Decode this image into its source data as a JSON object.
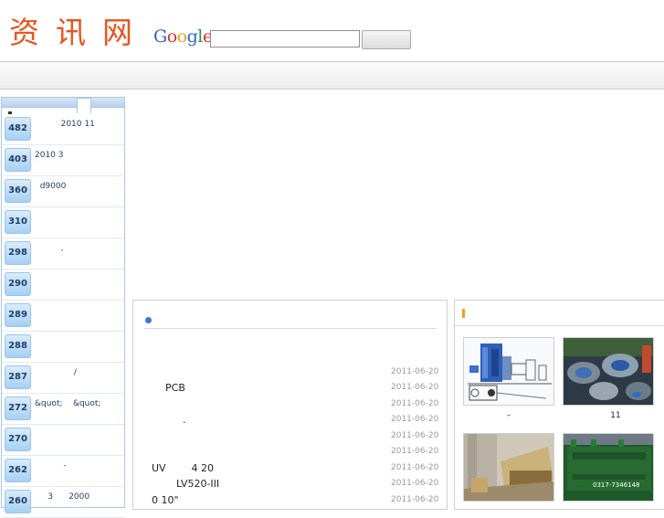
{
  "header": {
    "logo_text": "资讯网",
    "search_button_label": ""
  },
  "google_logo": [
    {
      "ch": "G",
      "color": "#2f62c9"
    },
    {
      "ch": "o",
      "color": "#d8322a"
    },
    {
      "ch": "o",
      "color": "#e8a617"
    },
    {
      "ch": "g",
      "color": "#2f62c9"
    },
    {
      "ch": "l",
      "color": "#2a9a3a"
    },
    {
      "ch": "e",
      "color": "#d8322a"
    }
  ],
  "sidebar": {
    "items": [
      {
        "count": "482",
        "text": "          2010 11"
      },
      {
        "count": "403",
        "text": "2010 3"
      },
      {
        "count": "360",
        "text": "  d9000"
      },
      {
        "count": "310",
        "text": ""
      },
      {
        "count": "298",
        "text": "          ,"
      },
      {
        "count": "290",
        "text": ""
      },
      {
        "count": "289",
        "text": ""
      },
      {
        "count": "288",
        "text": ""
      },
      {
        "count": "287",
        "text": "               /"
      },
      {
        "count": "272",
        "text": "&quot;    &quot;"
      },
      {
        "count": "270",
        "text": ""
      },
      {
        "count": "262",
        "text": "           -"
      },
      {
        "count": "260",
        "text": "     3      2000"
      }
    ]
  },
  "news": {
    "items": [
      {
        "title": "",
        "date": "2011-06-20",
        "indent": 20
      },
      {
        "title": "PCB",
        "date": "2011-06-20",
        "indent": 35
      },
      {
        "title": "",
        "date": "2011-06-20",
        "indent": 20
      },
      {
        "title": ".",
        "date": "2011-06-20",
        "indent": 54
      },
      {
        "title": "",
        "date": "2011-06-20",
        "indent": 20
      },
      {
        "title": "",
        "date": "2011-06-20",
        "indent": 20
      },
      {
        "title": "UV        4 20",
        "date": "2011-06-20",
        "indent": 20
      },
      {
        "title": "LV520-III",
        "date": "2011-06-20",
        "indent": 47
      },
      {
        "title": "0 10\"",
        "date": "2011-06-20",
        "indent": 20
      }
    ]
  },
  "photos": {
    "items": [
      {
        "caption": "–",
        "subject": "boiler-diagram"
      },
      {
        "caption": "11",
        "subject": "industrial-parts"
      },
      {
        "caption": "",
        "subject": "dump-truck"
      },
      {
        "caption": "",
        "subject": "green-generator",
        "phone": "0317-7346148"
      }
    ]
  },
  "colors": {
    "logo": "#e8541e",
    "accent_dot": "#3b78d3",
    "accent_bar": "#f39a2b",
    "badge_text": "#1f3f6a"
  }
}
